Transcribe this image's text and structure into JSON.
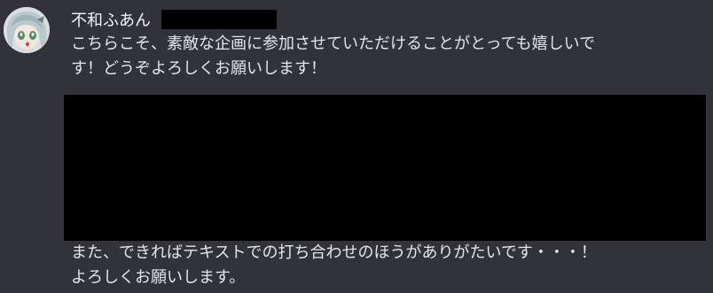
{
  "message": {
    "avatar_icon": "anime-girl-avatar-icon",
    "username": "不和ふあん",
    "lines_first": [
      "こちらこそ、素敵な企画に参加させていただけることがとっても嬉しいで",
      "す！どうぞよろしくお願いします！"
    ],
    "lines_second": [
      "また、できればテキストでの打ち合わせのほうがありがたいです・・・！",
      "よろしくお願いします。"
    ]
  },
  "colors": {
    "background": "#313338",
    "text": "#e3e5e8",
    "redaction": "#000000"
  }
}
